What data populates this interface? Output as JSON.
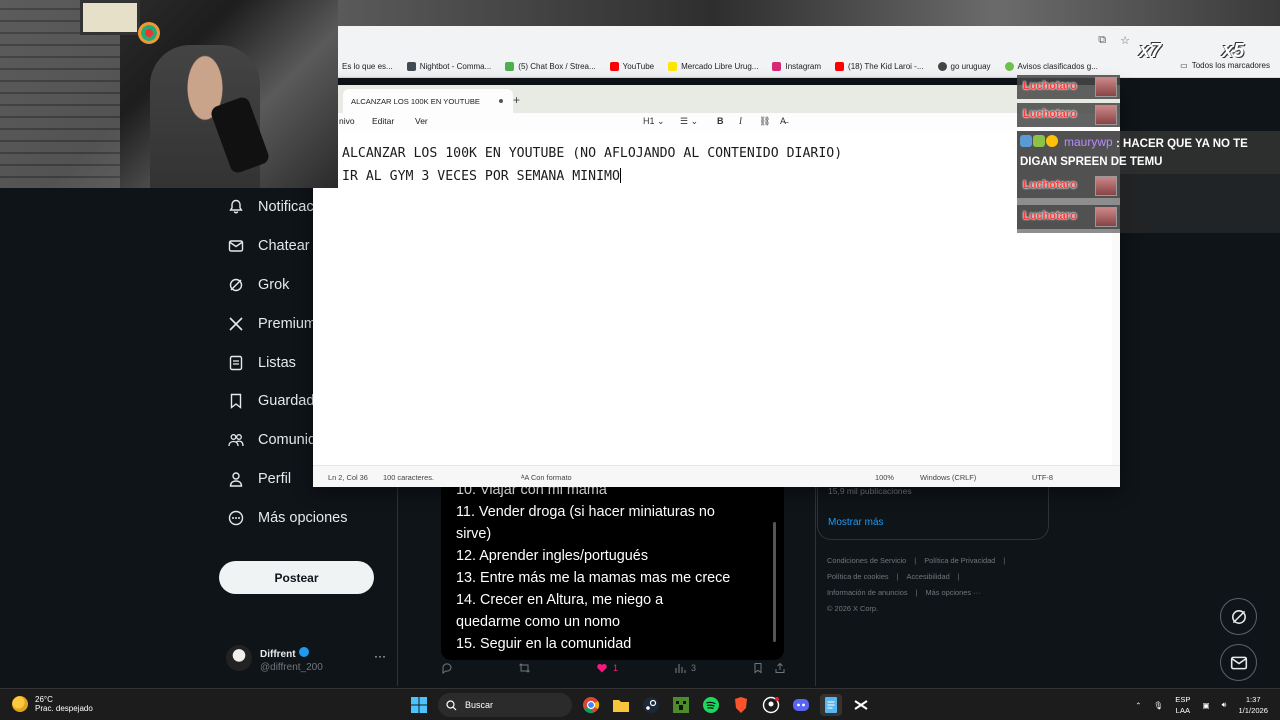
{
  "browser": {
    "bookmarks": [
      {
        "label": "Es lo que es...",
        "color": "#d9d9d9"
      },
      {
        "label": "Nightbot - Comma...",
        "color": "#444a55"
      },
      {
        "label": "(5) Chat Box / Strea...",
        "color": "#4caf50"
      },
      {
        "label": "YouTube",
        "color": "#ff0000"
      },
      {
        "label": "Mercado Libre Urug...",
        "color": "#ffe600"
      },
      {
        "label": "Instagram",
        "color": "#d62976"
      },
      {
        "label": "(18) The Kid Laroi -...",
        "color": "#ff0000"
      },
      {
        "label": "go uruguay",
        "color": "#444444"
      },
      {
        "label": "Avisos clasificados g...",
        "color": "#6cc24a"
      }
    ],
    "all_bookmarks": "Todos los marcadores"
  },
  "notepad": {
    "tab_title": "ALCANZAR LOS 100K EN YOUTUBE",
    "menu": {
      "file": "nivo",
      "edit": "Editar",
      "view": "Ver"
    },
    "format": {
      "heading": "H1"
    },
    "lines": [
      "ALCANZAR LOS 100K EN YOUTUBE (NO AFLOJANDO AL CONTENIDO DIARIO)",
      "IR AL GYM 3 VECES POR SEMANA MINIMO"
    ],
    "status": {
      "position": "Ln 2, Col 36",
      "chars": "100 caracteres.",
      "format": "Con formato",
      "zoom": "100%",
      "line_ending": "Windows (CRLF)",
      "encoding": "UTF-8"
    }
  },
  "x_nav": [
    {
      "label": "Notificac",
      "icon": "bell-icon"
    },
    {
      "label": "Chatear",
      "icon": "mail-icon"
    },
    {
      "label": "Grok",
      "icon": "grok-icon"
    },
    {
      "label": "Premium",
      "icon": "x-logo-icon"
    },
    {
      "label": "Listas",
      "icon": "list-icon"
    },
    {
      "label": "Guardad",
      "icon": "bookmark-icon"
    },
    {
      "label": "Comunid",
      "icon": "community-icon"
    },
    {
      "label": "Perfil",
      "icon": "person-icon"
    },
    {
      "label": "Más opciones",
      "icon": "more-circle-icon"
    }
  ],
  "post_button": "Postear",
  "profile": {
    "name": "Diffrent",
    "handle": "@diffrent_200"
  },
  "tweet": {
    "list": [
      "10. Viajar con mi mamá",
      "11. Vender droga (si hacer miniaturas no",
      "sirve)",
      "12. Aprender ingles/portugués",
      "13. Entre más me la mamas mas me crece",
      "14. Crecer en Altura, me niego a",
      "quedarme como un nomo",
      "15. Seguir en la comunidad"
    ],
    "likes": "1",
    "views": "3"
  },
  "side_panel": {
    "pubs": "15,9 mil publicaciones",
    "show_more": "Mostrar más"
  },
  "footer": [
    "Condiciones de Servicio",
    "|",
    "Política de Privacidad",
    "|",
    "Política de cookies",
    "|",
    "Accesibilidad",
    "|",
    "Información de anuncios",
    "|",
    "Más opciones ···",
    "© 2026 X Corp."
  ],
  "stream": {
    "chat_name": "Luchotaro",
    "msg_user": "maurywp",
    "msg_text": ": HACER QUE YA NO TE DIGAN SPREEN DE TEMU",
    "mult_a": "x7",
    "mult_b": "x5"
  },
  "taskbar": {
    "temp": "26°C",
    "weather": "Prac. despejado",
    "search": "Buscar",
    "lang_top": "ESP",
    "lang_bottom": "LAA",
    "time": "1:37",
    "date": "1/1/2026"
  }
}
